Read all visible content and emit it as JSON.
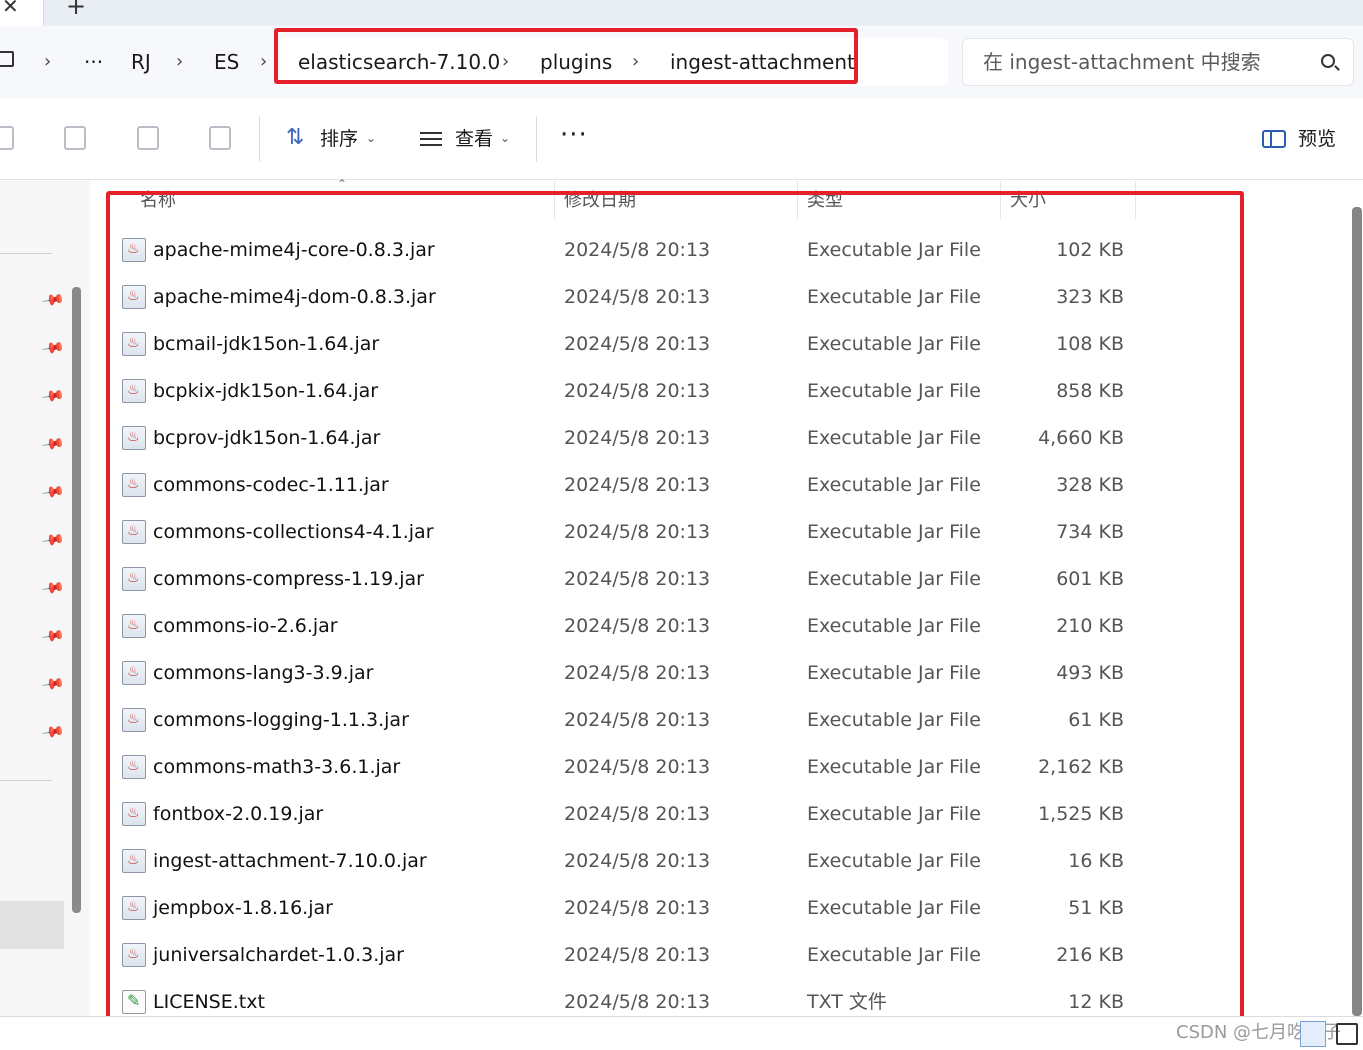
{
  "tab": {
    "close_glyph": "✕",
    "new_glyph": "+"
  },
  "breadcrumb": {
    "more": "···",
    "items": [
      "RJ",
      "ES",
      "elasticsearch-7.10.0",
      "plugins",
      "ingest-attachment"
    ],
    "separator": "›"
  },
  "search": {
    "placeholder": "在 ingest-attachment 中搜索"
  },
  "toolbar": {
    "sort_label": "排序",
    "view_label": "查看",
    "more_label": "···",
    "preview_label": "预览",
    "chevron": "⌄"
  },
  "columns": {
    "name": "名称",
    "date": "修改日期",
    "type": "类型",
    "size": "大小"
  },
  "files": [
    {
      "name": "apache-mime4j-core-0.8.3.jar",
      "date": "2024/5/8 20:13",
      "type": "Executable Jar File",
      "size": "102 KB",
      "icon": "jar-file-icon"
    },
    {
      "name": "apache-mime4j-dom-0.8.3.jar",
      "date": "2024/5/8 20:13",
      "type": "Executable Jar File",
      "size": "323 KB",
      "icon": "jar-file-icon"
    },
    {
      "name": "bcmail-jdk15on-1.64.jar",
      "date": "2024/5/8 20:13",
      "type": "Executable Jar File",
      "size": "108 KB",
      "icon": "jar-file-icon"
    },
    {
      "name": "bcpkix-jdk15on-1.64.jar",
      "date": "2024/5/8 20:13",
      "type": "Executable Jar File",
      "size": "858 KB",
      "icon": "jar-file-icon"
    },
    {
      "name": "bcprov-jdk15on-1.64.jar",
      "date": "2024/5/8 20:13",
      "type": "Executable Jar File",
      "size": "4,660 KB",
      "icon": "jar-file-icon"
    },
    {
      "name": "commons-codec-1.11.jar",
      "date": "2024/5/8 20:13",
      "type": "Executable Jar File",
      "size": "328 KB",
      "icon": "jar-file-icon"
    },
    {
      "name": "commons-collections4-4.1.jar",
      "date": "2024/5/8 20:13",
      "type": "Executable Jar File",
      "size": "734 KB",
      "icon": "jar-file-icon"
    },
    {
      "name": "commons-compress-1.19.jar",
      "date": "2024/5/8 20:13",
      "type": "Executable Jar File",
      "size": "601 KB",
      "icon": "jar-file-icon"
    },
    {
      "name": "commons-io-2.6.jar",
      "date": "2024/5/8 20:13",
      "type": "Executable Jar File",
      "size": "210 KB",
      "icon": "jar-file-icon"
    },
    {
      "name": "commons-lang3-3.9.jar",
      "date": "2024/5/8 20:13",
      "type": "Executable Jar File",
      "size": "493 KB",
      "icon": "jar-file-icon"
    },
    {
      "name": "commons-logging-1.1.3.jar",
      "date": "2024/5/8 20:13",
      "type": "Executable Jar File",
      "size": "61 KB",
      "icon": "jar-file-icon"
    },
    {
      "name": "commons-math3-3.6.1.jar",
      "date": "2024/5/8 20:13",
      "type": "Executable Jar File",
      "size": "2,162 KB",
      "icon": "jar-file-icon"
    },
    {
      "name": "fontbox-2.0.19.jar",
      "date": "2024/5/8 20:13",
      "type": "Executable Jar File",
      "size": "1,525 KB",
      "icon": "jar-file-icon"
    },
    {
      "name": "ingest-attachment-7.10.0.jar",
      "date": "2024/5/8 20:13",
      "type": "Executable Jar File",
      "size": "16 KB",
      "icon": "jar-file-icon"
    },
    {
      "name": "jempbox-1.8.16.jar",
      "date": "2024/5/8 20:13",
      "type": "Executable Jar File",
      "size": "51 KB",
      "icon": "jar-file-icon"
    },
    {
      "name": "juniversalchardet-1.0.3.jar",
      "date": "2024/5/8 20:13",
      "type": "Executable Jar File",
      "size": "216 KB",
      "icon": "jar-file-icon"
    },
    {
      "name": "LICENSE.txt",
      "date": "2024/5/8 20:13",
      "type": "TXT 文件",
      "size": "12 KB",
      "icon": "txt-file-icon"
    }
  ],
  "watermark": "CSDN @七月吃橘子",
  "colors": {
    "highlight_red": "#e4202a",
    "accent_blue": "#2a5db0"
  }
}
